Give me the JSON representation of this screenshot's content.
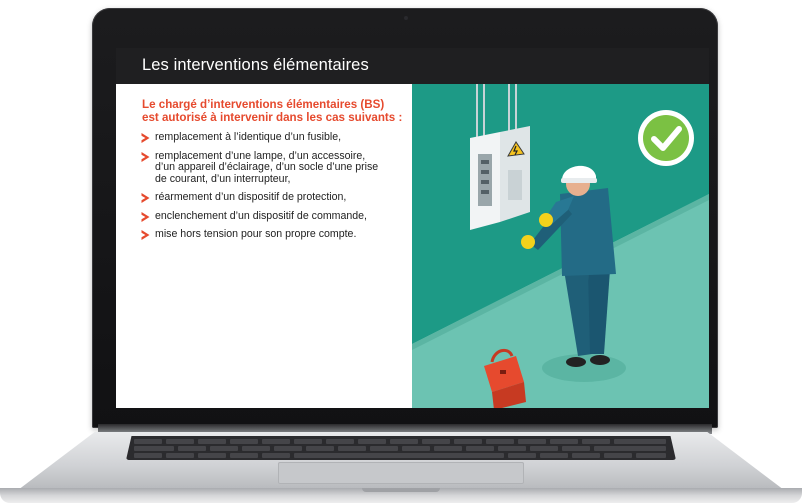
{
  "slide": {
    "title": "Les interventions élémentaires",
    "intro_line1": "Le chargé d’interventions élémentaires (BS)",
    "intro_line2": "est autorisé à intervenir dans les cas suivants :",
    "items": [
      {
        "lines": [
          "remplacement à l’identique d’un fusible,"
        ]
      },
      {
        "lines": [
          "remplacement d’une lampe, d’un accessoire,",
          "d’un appareil d’éclairage, d’un socle d’une prise",
          "de courant, d’un interrupteur,"
        ]
      },
      {
        "lines": [
          "réarmement d’un dispositif de protection,"
        ]
      },
      {
        "lines": [
          "enclenchement d’un dispositif de commande,"
        ]
      },
      {
        "lines": [
          "mise hors tension pour son propre compte."
        ]
      }
    ]
  },
  "colors": {
    "accent": "#e64a2e",
    "panel_teal": "#1d9a86",
    "panel_teal_light": "#74c8b7",
    "check_green": "#7bc143"
  },
  "illustration": {
    "icons": [
      "checkmark-circle-icon",
      "electrical-panel-icon",
      "technician-figure",
      "toolbox-icon"
    ]
  }
}
